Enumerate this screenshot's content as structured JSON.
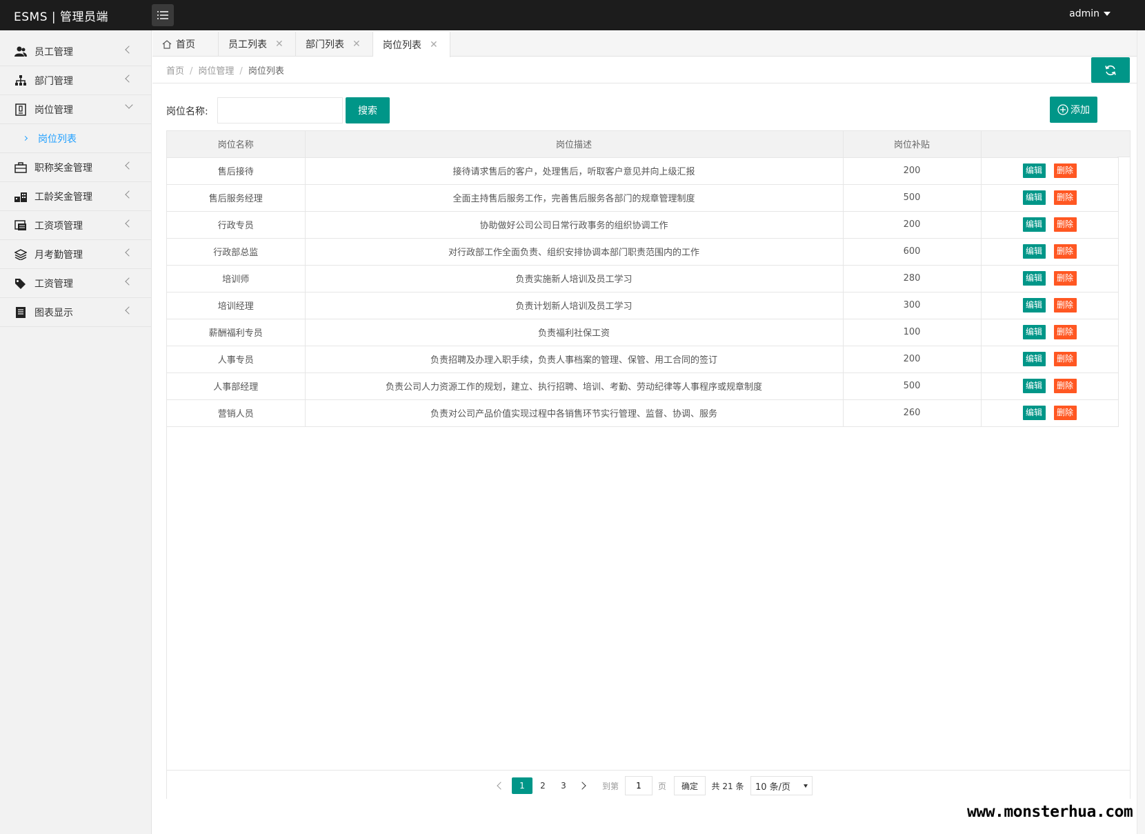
{
  "header": {
    "brand": "ESMS | 管理员端",
    "user": "admin"
  },
  "sidebar": {
    "items": [
      {
        "label": "员工管理",
        "icon": "users-icon"
      },
      {
        "label": "部门管理",
        "icon": "sitemap-icon"
      },
      {
        "label": "岗位管理",
        "icon": "id-card-icon",
        "open": true,
        "children": [
          {
            "label": "岗位列表"
          }
        ]
      },
      {
        "label": "职称奖金管理",
        "icon": "briefcase-icon"
      },
      {
        "label": "工龄奖金管理",
        "icon": "building-icon"
      },
      {
        "label": "工资项管理",
        "icon": "list-window-icon"
      },
      {
        "label": "月考勤管理",
        "icon": "layers-icon"
      },
      {
        "label": "工资管理",
        "icon": "tags-icon"
      },
      {
        "label": "图表显示",
        "icon": "document-icon"
      }
    ]
  },
  "tabs": [
    {
      "label": "首页",
      "closable": false
    },
    {
      "label": "员工列表",
      "closable": true
    },
    {
      "label": "部门列表",
      "closable": true
    },
    {
      "label": "岗位列表",
      "closable": true,
      "active": true
    }
  ],
  "breadcrumb": {
    "home": "首页",
    "section": "岗位管理",
    "current": "岗位列表"
  },
  "search": {
    "label": "岗位名称:",
    "value": "",
    "button": "搜索"
  },
  "add_button": "添加",
  "table": {
    "columns": [
      "岗位名称",
      "岗位描述",
      "岗位补贴",
      ""
    ],
    "edit_label": "编辑",
    "delete_label": "删除",
    "rows": [
      {
        "name": "售后接待",
        "desc": "接待请求售后的客户，处理售后，听取客户意见并向上级汇报",
        "allowance": "200"
      },
      {
        "name": "售后服务经理",
        "desc": "全面主持售后服务工作，完善售后服务各部门的规章管理制度",
        "allowance": "500"
      },
      {
        "name": "行政专员",
        "desc": "协助做好公司公司日常行政事务的组织协调工作",
        "allowance": "200"
      },
      {
        "name": "行政部总监",
        "desc": "对行政部工作全面负责、组织安排协调本部门职责范围内的工作",
        "allowance": "600"
      },
      {
        "name": "培训师",
        "desc": "负责实施新人培训及员工学习",
        "allowance": "280"
      },
      {
        "name": "培训经理",
        "desc": "负责计划新人培训及员工学习",
        "allowance": "300"
      },
      {
        "name": "薪酬福利专员",
        "desc": "负责福利社保工资",
        "allowance": "100"
      },
      {
        "name": "人事专员",
        "desc": "负责招聘及办理入职手续，负责人事档案的管理、保管、用工合同的签订",
        "allowance": "200"
      },
      {
        "name": "人事部经理",
        "desc": "负责公司人力资源工作的规划，建立、执行招聘、培训、考勤、劳动纪律等人事程序或规章制度",
        "allowance": "500"
      },
      {
        "name": "营销人员",
        "desc": "负责对公司产品价值实现过程中各销售环节实行管理、监督、协调、服务",
        "allowance": "260"
      }
    ]
  },
  "pagination": {
    "pages": [
      "1",
      "2",
      "3"
    ],
    "current": "1",
    "goto_label": "到第",
    "page_unit": "页",
    "goto_value": "1",
    "confirm": "确定",
    "total": "共 21 条",
    "page_size": "10 条/页"
  },
  "watermark": "www.monsterhua.com",
  "colors": {
    "primary": "#009688",
    "danger": "#ff5722",
    "header": "#1c1c1c",
    "link": "#1e9fff"
  }
}
